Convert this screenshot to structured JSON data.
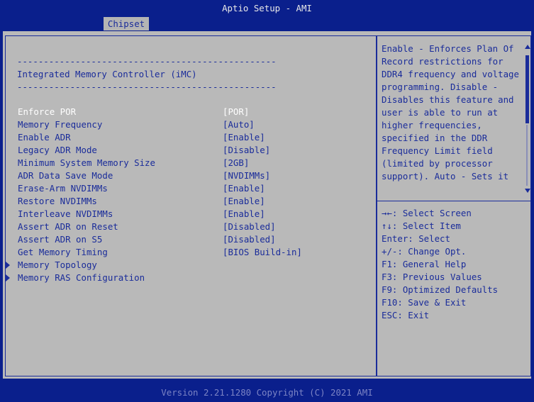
{
  "app_title": "Aptio Setup - AMI",
  "tab": "Chipset",
  "divider": "-------------------------------------------------",
  "section_title": "Integrated Memory Controller (iMC)",
  "items": [
    {
      "label": "Enforce POR",
      "value": "[POR]",
      "selected": true
    },
    {
      "label": "Memory Frequency",
      "value": "[Auto]"
    },
    {
      "label": "Enable ADR",
      "value": "[Enable]"
    },
    {
      "label": "Legacy ADR Mode",
      "value": "[Disable]"
    },
    {
      "label": "Minimum System Memory Size",
      "value": "[2GB]"
    },
    {
      "label": "ADR Data Save Mode",
      "value": "[NVDIMMs]"
    },
    {
      "label": "Erase-Arm NVDIMMs",
      "value": "[Enable]"
    },
    {
      "label": "Restore NVDIMMs",
      "value": "[Enable]"
    },
    {
      "label": "Interleave NVDIMMs",
      "value": "[Enable]"
    },
    {
      "label": "Assert ADR on Reset",
      "value": "[Disabled]"
    },
    {
      "label": "Assert ADR on S5",
      "value": "[Disabled]"
    },
    {
      "label": "Get Memory Timing",
      "value": "[BIOS Build-in]"
    },
    {
      "label": "Memory Topology",
      "value": ""
    },
    {
      "label": "Memory RAS Configuration",
      "value": ""
    }
  ],
  "help_lines": [
    "Enable - Enforces Plan Of",
    "Record restrictions for",
    "DDR4 frequency and voltage",
    "programming. Disable -",
    "Disables this feature and",
    "user is able to run at",
    "higher frequencies,",
    "specified in the DDR",
    "Frequency Limit field",
    "(limited by processor",
    "support). Auto - Sets it"
  ],
  "key_help": [
    "→←: Select Screen",
    "↑↓: Select Item",
    "Enter: Select",
    "+/-: Change Opt.",
    "F1: General Help",
    "F3: Previous Values",
    "F9: Optimized Defaults",
    "F10: Save & Exit",
    "ESC: Exit"
  ],
  "footer": "Version 2.21.1280 Copyright (C) 2021 AMI",
  "colors": {
    "background": "#0a1f8c",
    "panel": "#b9b9b9",
    "text": "#1a2c9a",
    "selected": "#ffffff"
  }
}
